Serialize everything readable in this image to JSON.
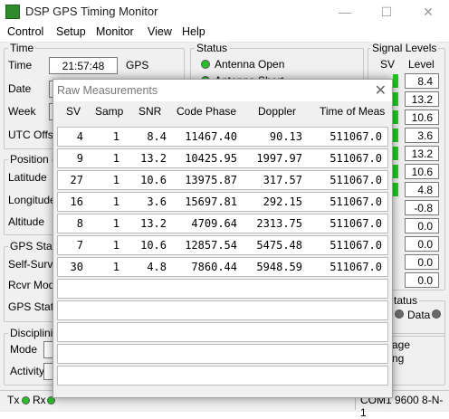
{
  "window": {
    "title": "DSP GPS Timing Monitor",
    "minimize": "—",
    "maximize": "☐",
    "close": "✕"
  },
  "menu": [
    "Control",
    "Setup",
    "Monitor",
    "View",
    "Help"
  ],
  "time": {
    "group": "Time",
    "time_label": "Time",
    "time_value": "21:57:48",
    "time_unit": "GPS",
    "date_label": "Date",
    "week_label": "Week",
    "utc_label": "UTC Offse"
  },
  "position": {
    "group": "Position (D",
    "lat": "Latitude",
    "lon": "Longitude",
    "alt": "Altitude"
  },
  "gps_status": {
    "group": "GPS Statu",
    "self_survey": "Self-Survey",
    "rcvr_mode": "Rcvr Mode",
    "gps_status": "GPS Statu"
  },
  "discipline": {
    "group": "Disciplinin",
    "mode": "Mode",
    "activity": "Activity",
    "age": "age",
    "ng": "ng"
  },
  "status": {
    "group": "Status",
    "antenna_open": "Antenna Open",
    "antenna_short": "Antenna Short"
  },
  "signal": {
    "group": "Signal Levels",
    "sv_header": "SV",
    "level_header": "Level",
    "levels": [
      "8.4",
      "13.2",
      "10.6",
      "3.6",
      "13.2",
      "10.6",
      "4.8",
      "-0.8",
      "0.0",
      "0.0",
      "0.0",
      "0.0"
    ],
    "green_bars": 7
  },
  "stats": {
    "group": "tatus",
    "data_label": "Data"
  },
  "statusbar": {
    "tx": "Tx",
    "rx": "Rx",
    "port": "COM1 9600 8-N-1"
  },
  "dialog": {
    "title": "Raw Measurements",
    "close": "✕",
    "columns": [
      "SV",
      "Samp",
      "SNR",
      "Code Phase",
      "Doppler",
      "Time of Meas"
    ],
    "rows": [
      [
        "4",
        "1",
        "8.4",
        "11467.40",
        "90.13",
        "511067.0"
      ],
      [
        "9",
        "1",
        "13.2",
        "10425.95",
        "1997.97",
        "511067.0"
      ],
      [
        "27",
        "1",
        "10.6",
        "13975.87",
        "317.57",
        "511067.0"
      ],
      [
        "16",
        "1",
        "3.6",
        "15697.81",
        "292.15",
        "511067.0"
      ],
      [
        "8",
        "1",
        "13.2",
        "4709.64",
        "2313.75",
        "511067.0"
      ],
      [
        "7",
        "1",
        "10.6",
        "12857.54",
        "5475.48",
        "511067.0"
      ],
      [
        "30",
        "1",
        "4.8",
        "7860.44",
        "5948.59",
        "511067.0"
      ]
    ],
    "empty_rows": 5
  },
  "colors": {
    "led_green": "#28c028",
    "signal_bar": "#22cc22"
  }
}
